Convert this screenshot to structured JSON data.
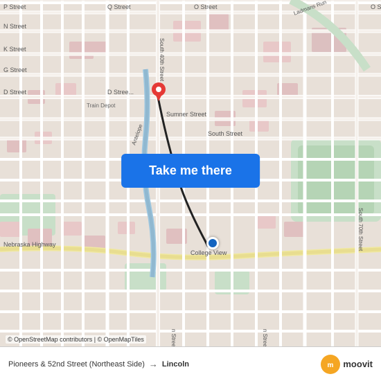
{
  "map": {
    "background_color": "#e8e0d8",
    "streets": {
      "labels": [
        "P Street",
        "Q Street",
        "N Street",
        "K Street",
        "G Street",
        "D Street",
        "D Stree",
        "Sumner Street",
        "South Street",
        "Nebraska Highway",
        "O Street",
        "O S",
        "South 40th Street",
        "Antelope",
        "South 70th Street",
        "Train Depot",
        "College View"
      ]
    }
  },
  "button": {
    "label": "Take me there"
  },
  "bottom_bar": {
    "attribution": "© OpenStreetMap contributors | © OpenMapTiles",
    "route_from": "Pioneers & 52nd Street (Northeast Side)",
    "route_arrow": "→",
    "route_to": "Lincoln",
    "moovit_label": "moovit"
  }
}
